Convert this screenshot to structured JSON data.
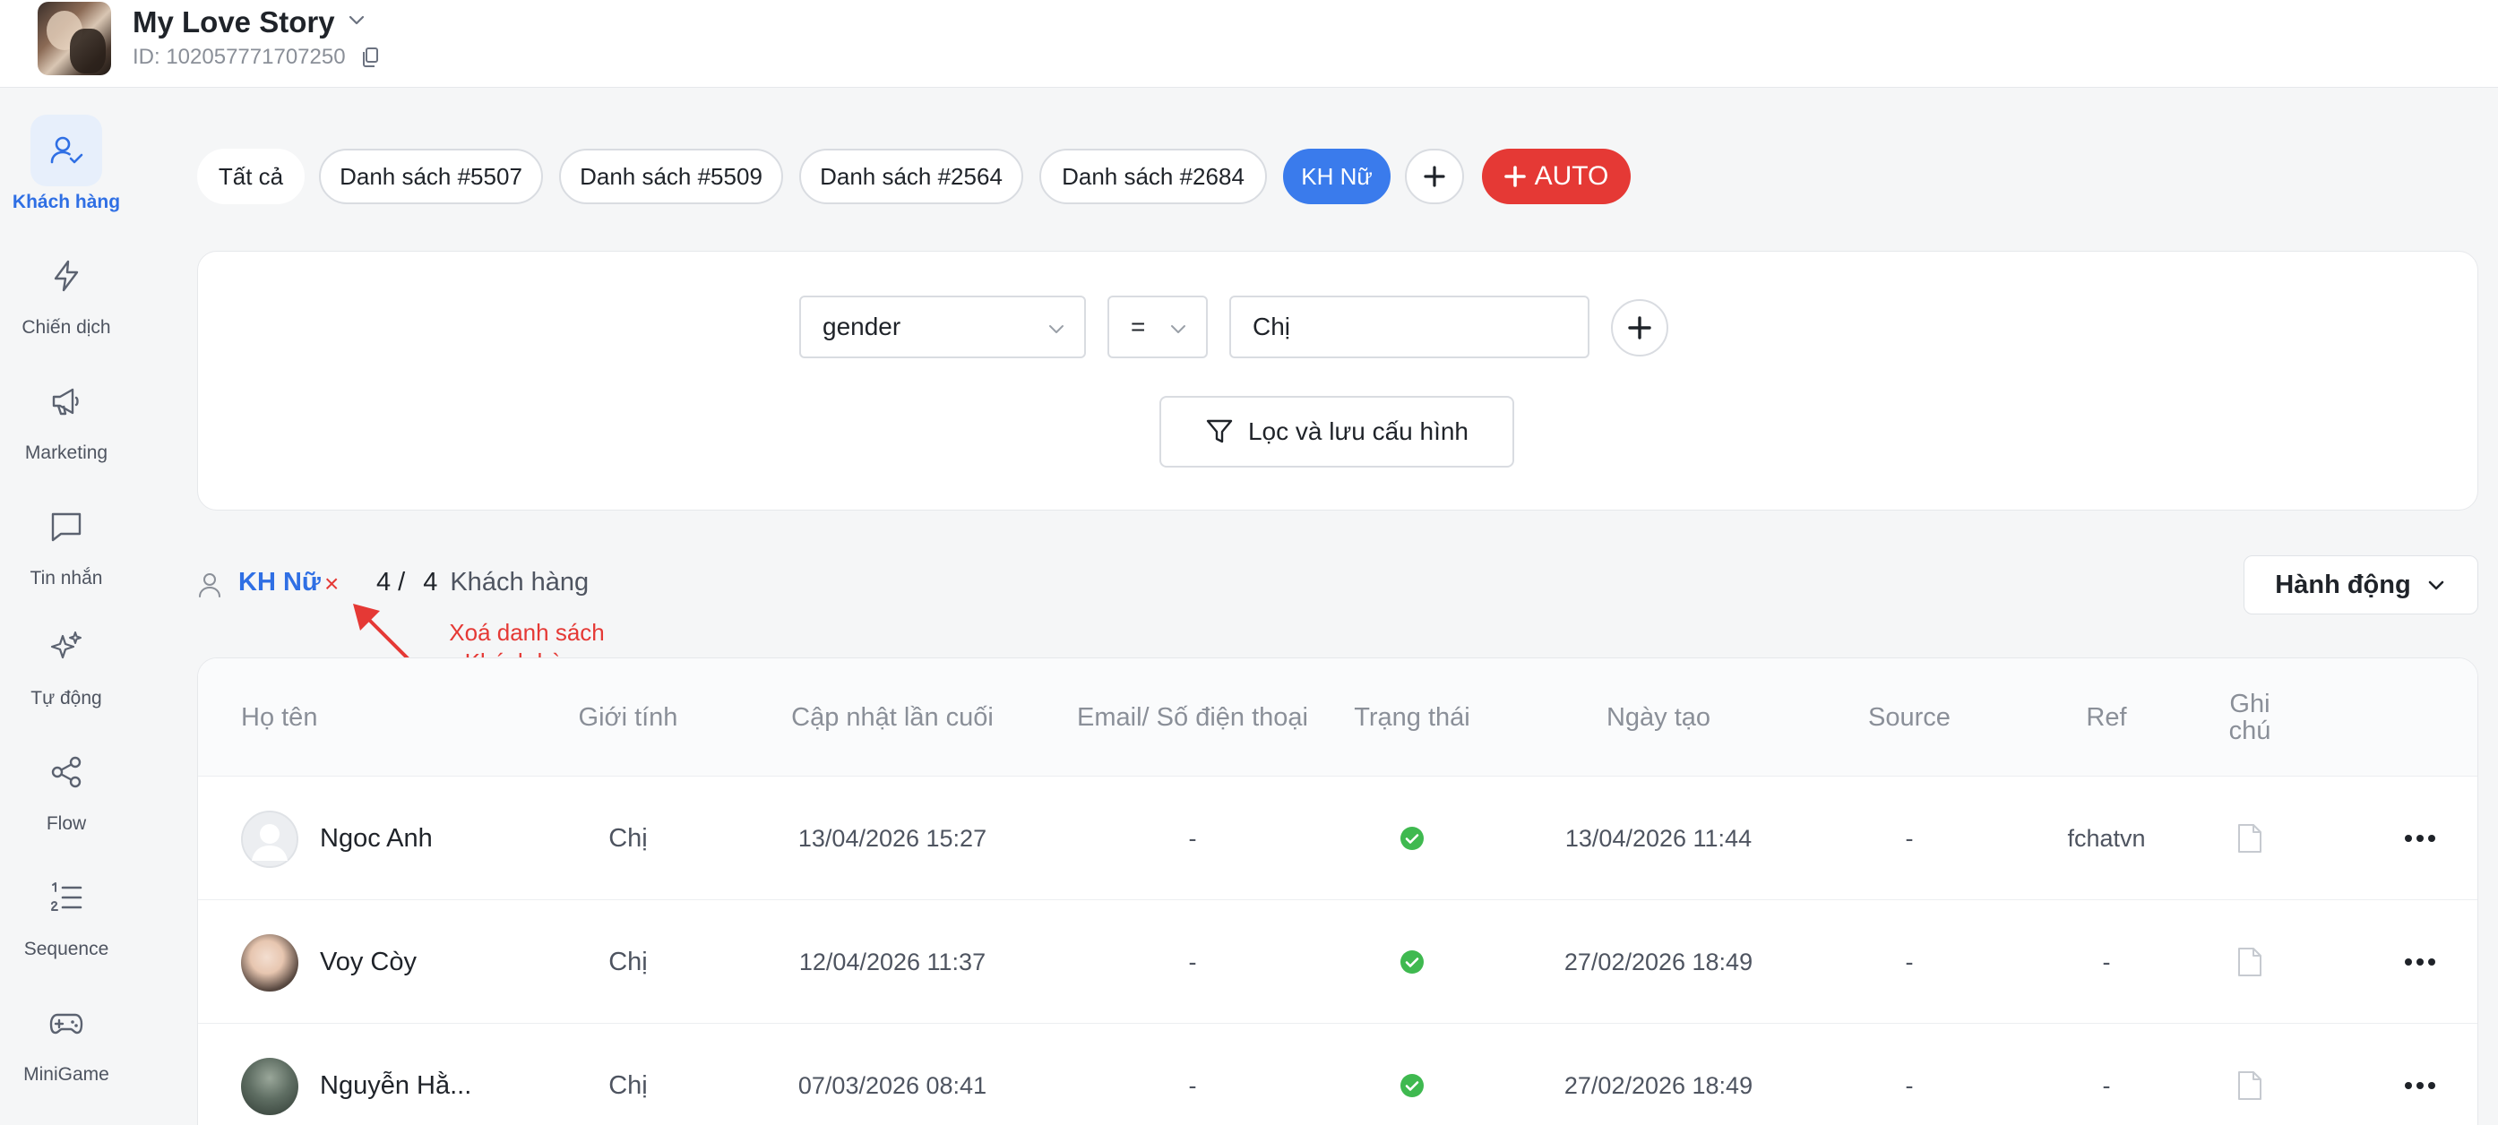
{
  "header": {
    "title": "My Love Story",
    "id_text": "ID: 102057771707250"
  },
  "sidebar": {
    "items": [
      {
        "label": "Khách hàng",
        "icon": "user-check-icon",
        "active": true
      },
      {
        "label": "Chiến dịch",
        "icon": "lightning-icon"
      },
      {
        "label": "Marketing",
        "icon": "megaphone-icon"
      },
      {
        "label": "Tin nhắn",
        "icon": "message-icon"
      },
      {
        "label": "Tự động",
        "icon": "sparkles-icon"
      },
      {
        "label": "Flow",
        "icon": "share-icon"
      },
      {
        "label": "Sequence",
        "icon": "numbered-list-icon"
      },
      {
        "label": "MiniGame",
        "icon": "gamepad-icon"
      }
    ]
  },
  "tabs": [
    {
      "label": "Tất cả"
    },
    {
      "label": "Danh sách #5507"
    },
    {
      "label": "Danh sách #5509"
    },
    {
      "label": "Danh sách #2564"
    },
    {
      "label": "Danh sách #2684"
    },
    {
      "label": "KH Nữ",
      "active": true
    }
  ],
  "auto_button": "AUTO",
  "filter": {
    "field": "gender",
    "operator": "=",
    "value": "Chị",
    "save_label": "Lọc và lưu cấu hình"
  },
  "list": {
    "name": "KH Nữ",
    "remove": "×",
    "shown": "4",
    "separator": "/",
    "total": "4",
    "unit": "Khách hàng",
    "action_label": "Hành động"
  },
  "annotation": {
    "line1": "Xoá danh sách",
    "line2": "Khách hàng",
    "color": "#e53935"
  },
  "table": {
    "headers": [
      "Họ tên",
      "Giới tính",
      "Cập nhật lần cuối",
      "Email/ Số điện thoại",
      "Trạng thái",
      "Ngày tạo",
      "Source",
      "Ref",
      "Ghi chú"
    ],
    "rows": [
      {
        "name": "Ngoc Anh",
        "gender": "Chị",
        "updated": "13/04/2026 15:27",
        "contact": "-",
        "status": "active",
        "created": "13/04/2026 11:44",
        "source": "-",
        "ref": "fchatvn"
      },
      {
        "name": "Voy Còy",
        "gender": "Chị",
        "updated": "12/04/2026 11:37",
        "contact": "-",
        "status": "active",
        "created": "27/02/2026 18:49",
        "source": "-",
        "ref": "-"
      },
      {
        "name": "Nguyễn Hằ...",
        "gender": "Chị",
        "updated": "07/03/2026 08:41",
        "contact": "-",
        "status": "active",
        "created": "27/02/2026 18:49",
        "source": "-",
        "ref": "-"
      }
    ]
  },
  "colors": {
    "accent": "#3a7bec",
    "danger": "#e53935",
    "success": "#3fb950"
  }
}
